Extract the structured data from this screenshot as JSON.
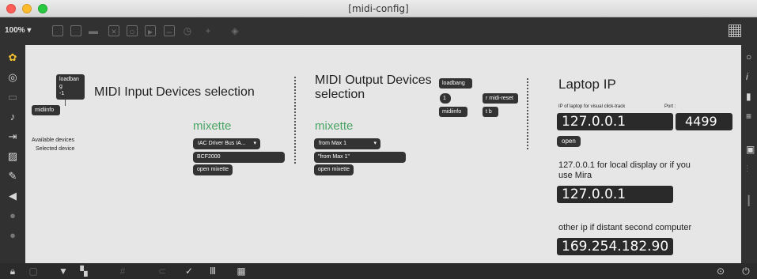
{
  "window": {
    "title": "[midi-config]"
  },
  "toolbar": {
    "zoom": "100% ▾"
  },
  "canvas": {
    "input": {
      "loadbang_label": "loadban\ng\n-1",
      "midiinfo_label": "midiinfo",
      "title": "MIDI Input Devices selection",
      "mixette": "mixette",
      "available_label": "Available devices",
      "selected_label": "Selected device",
      "device_menu": "IAC Driver Bus IA...",
      "selected_value": "BCF2000",
      "open_msg": "open mixette"
    },
    "output": {
      "title": "MIDI Output Devices\nselection",
      "mixette": "mixette",
      "device_menu": "from Max 1",
      "selected_value": "\"from Max 1\"",
      "open_msg": "open mixette",
      "loadbang_label": "loadbang",
      "one_label": "1",
      "midiinfo_label": "midiinfo",
      "midireset_label": "r midi-reset",
      "tb_label": "t b"
    },
    "laptop": {
      "title": "Laptop IP",
      "ip_caption": "IP of laptop for visual click-track",
      "port_caption": "Port :",
      "ip_value": "127.0.0.1",
      "port_value": "4499",
      "open_label": "open",
      "local_note": "127.0.0.1 for local display or if you\nuse Mira",
      "local_ip": "127.0.0.1",
      "distant_note": "other ip if distant second computer",
      "distant_ip": "169.254.182.90"
    }
  }
}
